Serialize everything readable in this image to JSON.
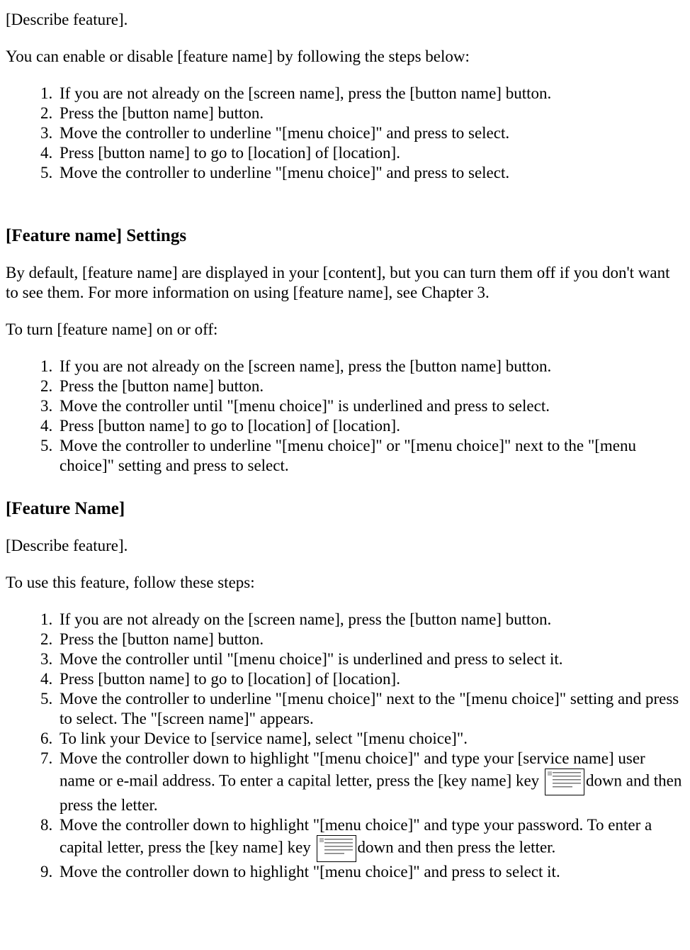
{
  "section1": {
    "describe": "[Describe feature].",
    "intro": "You can enable or disable [feature name] by following the steps below:",
    "steps": [
      "If you are not already on the [screen name], press the [button name] button.",
      "Press the [button name] button.",
      "Move the controller to underline \"[menu choice]\" and press to select.",
      "Press [button name] to go to [location] of [location].",
      "Move the controller to underline \"[menu choice]\" and press to select."
    ]
  },
  "section2": {
    "heading": "[Feature name] Settings",
    "intro1": "By default, [feature name] are displayed in your [content], but you can turn them off if you don't want to see them. For more information on using [feature name], see Chapter 3.",
    "intro2": "To turn [feature name] on or off:",
    "steps": [
      "If you are not already on the [screen name], press the [button name] button.",
      "Press the [button name] button.",
      "Move the controller until \"[menu choice]\" is underlined and press to select.",
      "Press [button name] to go to [location] of [location].",
      "Move the controller to underline \"[menu choice]\" or \"[menu choice]\" next to the \"[menu choice]\" setting and press to select."
    ]
  },
  "section3": {
    "heading": "[Feature Name]",
    "describe": "[Describe feature].",
    "intro": "To use this feature, follow these steps:",
    "steps_part_a": [
      "If you are not already on the [screen name], press the [button name] button.",
      "Press the [button name] button.",
      "Move the controller until \"[menu choice]\" is underlined and press to select it.",
      "Press [button name] to go to [location] of [location].",
      "Move the controller to underline \"[menu choice]\" next to the \"[menu choice]\" setting and press to select. The \"[screen name]\" appears.",
      "To link your Device to [service name], select \"[menu choice]\"."
    ],
    "step7_a": "Move the controller down to highlight \"[menu choice]\" and type your [service name] user name or e-mail address. To enter a capital letter, press the [key name] key ",
    "step7_b": "down and then press the letter.",
    "step8_a": "Move the controller down to highlight \"[menu choice]\" and type your password. To enter a capital letter, press the [key name] key ",
    "step8_b": "down and then press the letter.",
    "step9": "Move the controller down to highlight \"[menu choice]\" and press to select it."
  }
}
